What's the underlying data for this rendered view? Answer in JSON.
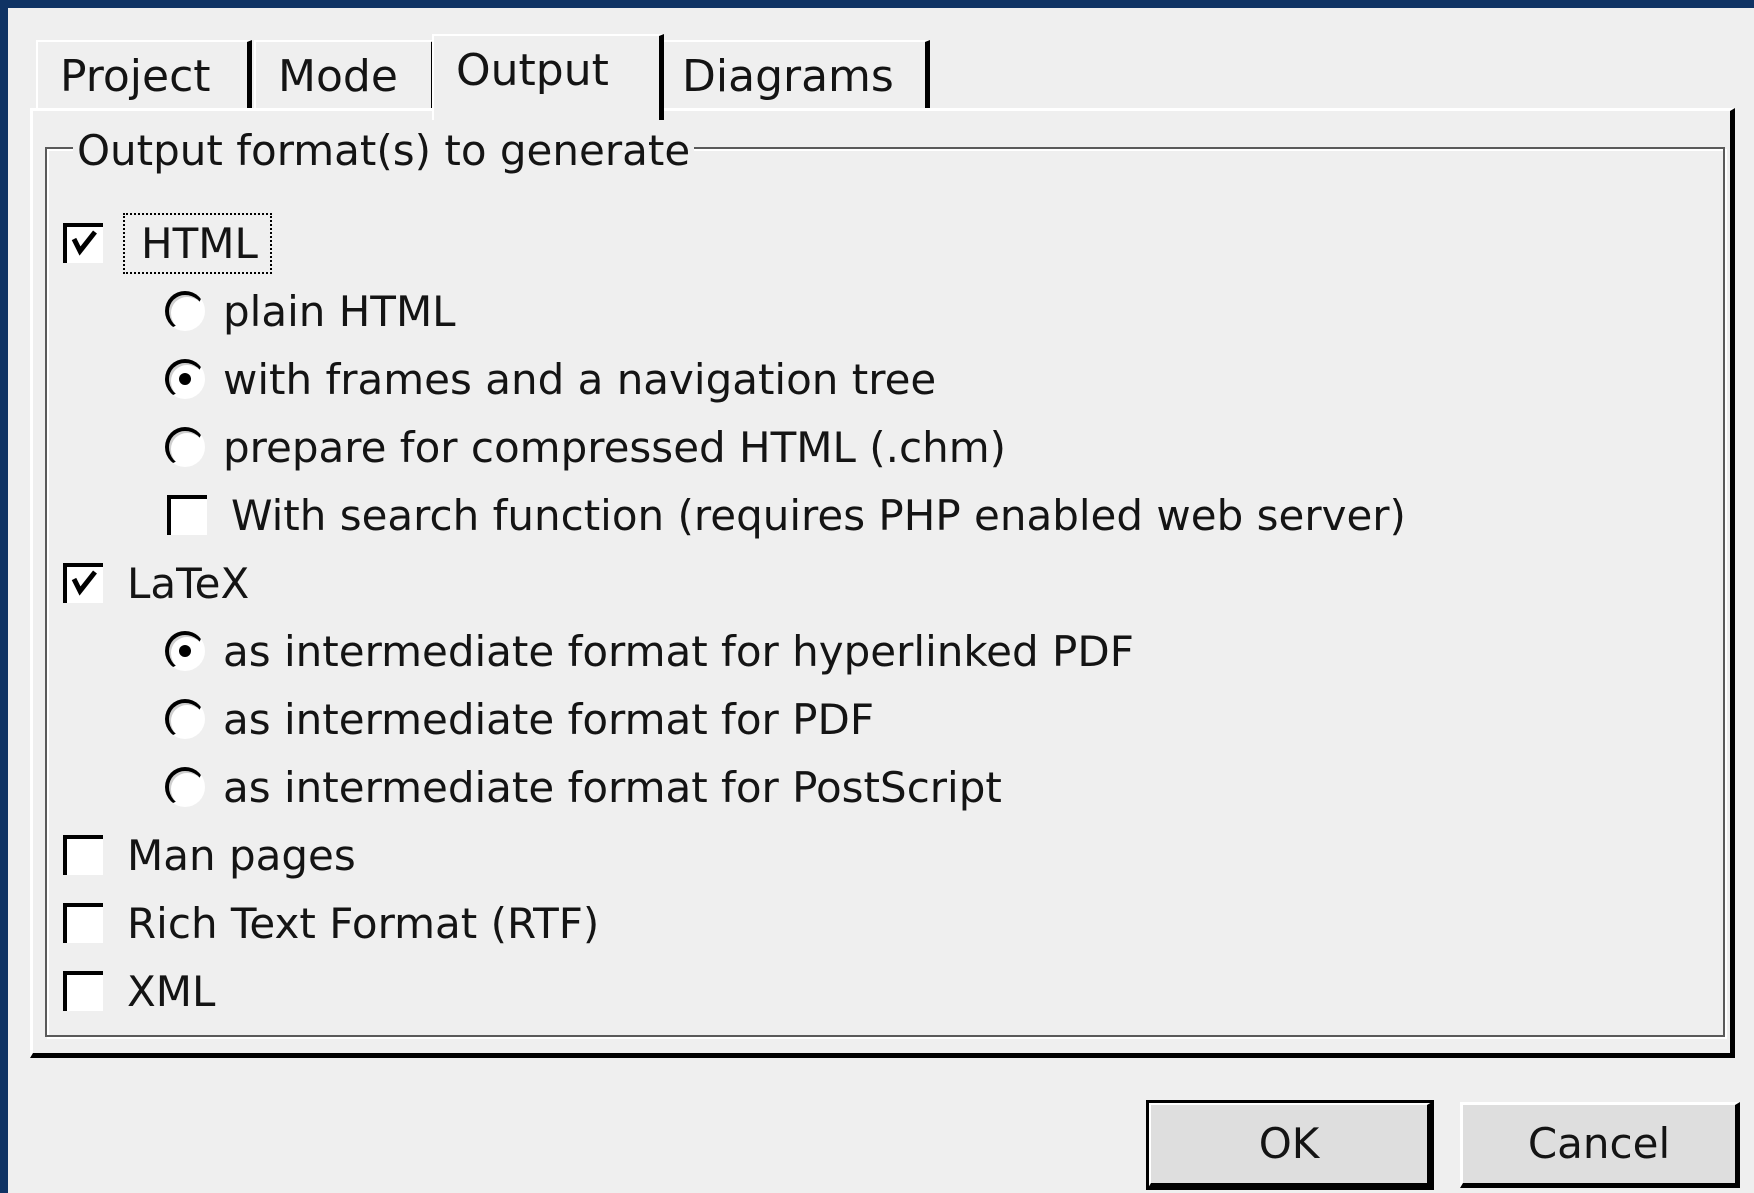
{
  "tabs": [
    {
      "label": "Project",
      "active": false
    },
    {
      "label": "Mode",
      "active": false
    },
    {
      "label": "Output",
      "active": true
    },
    {
      "label": "Diagrams",
      "active": false
    }
  ],
  "group": {
    "title": "Output format(s) to generate"
  },
  "options": {
    "html": {
      "label": "HTML",
      "checked": true
    },
    "html_plain": {
      "label": "plain HTML",
      "selected": false
    },
    "html_frames": {
      "label": "with frames and a navigation tree",
      "selected": true
    },
    "html_chm": {
      "label": "prepare for compressed HTML (.chm)",
      "selected": false
    },
    "html_search": {
      "label": "With search function (requires PHP enabled web server)",
      "checked": false
    },
    "latex": {
      "label": "LaTeX",
      "checked": true
    },
    "latex_hyperlinked_pdf": {
      "label": "as intermediate format for hyperlinked PDF",
      "selected": true
    },
    "latex_pdf": {
      "label": "as intermediate format for PDF",
      "selected": false
    },
    "latex_postscript": {
      "label": "as intermediate format for PostScript",
      "selected": false
    },
    "man": {
      "label": "Man pages",
      "checked": false
    },
    "rtf": {
      "label": "Rich Text Format (RTF)",
      "checked": false
    },
    "xml": {
      "label": "XML",
      "checked": false
    }
  },
  "buttons": {
    "ok": "OK",
    "cancel": "Cancel"
  },
  "colors": {
    "window_frame": "#0f3364",
    "dialog_bg": "#efefef",
    "button_bg": "#dedede"
  }
}
